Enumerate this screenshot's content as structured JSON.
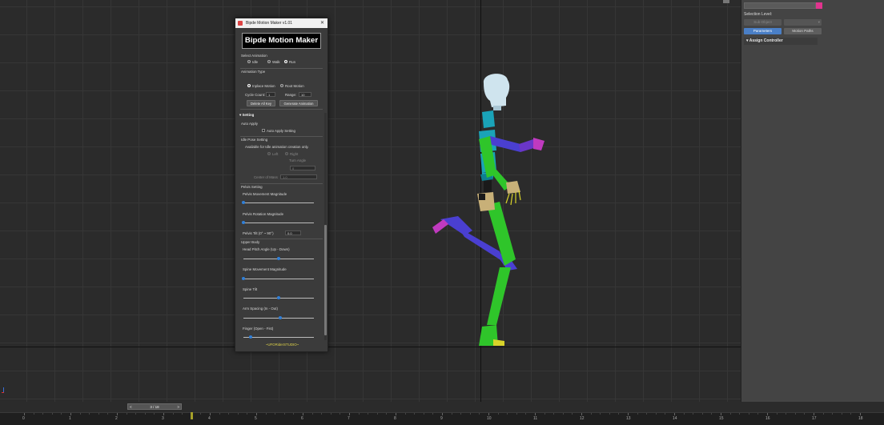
{
  "dialog": {
    "title": "Bipde Motion Maker v1.01",
    "logo_text": "Bipde Motion Maker",
    "close_glyph": "✕",
    "select_animation": {
      "label": "Select Animation",
      "options": [
        "Idle",
        "Walk",
        "Run"
      ],
      "selected": "Run"
    },
    "animation_type": {
      "label": "Animation Type",
      "options": [
        "Inplace Motion",
        "Root Motion"
      ],
      "selected": "Inplace Motion",
      "cycle_count_label": "Cycle Count:",
      "cycle_count_value": "1",
      "range_label": "Range:",
      "range_value": "10",
      "delete_button": "Delete All Key",
      "generate_button": "Generate Animation"
    },
    "setting": {
      "header": "Setting",
      "auto_apply_label": "Auto Apply",
      "auto_apply_checkbox": "Auto Apply Setting",
      "idle_pose_label": "Idle Pose Setting",
      "idle_pose_note": "Available for Idle animation creation only.",
      "left_label": "Left",
      "right_label": "Right",
      "turn_angle_label": "Turn Angle",
      "turn_angle_value": "0",
      "center_of_mass_label": "Center of Mass",
      "center_of_mass_value": "1.0"
    },
    "pelvis": {
      "label": "Pelvis Setting",
      "movement_label": "Pelvis Movement Magnitude",
      "movement_value": 0.0,
      "rotation_label": "Pelvis Rotation Magnitude",
      "rotation_value": 0.0,
      "tilt_label": "Pelvis Tilt (0° ~ 90°)",
      "tilt_value": "0.0"
    },
    "upper_body": {
      "label": "Upper Body",
      "head_pitch_label": "Head Pitch Angle (Up - Down)",
      "head_pitch_value": 0.5,
      "spine_movement_label": "Spine Movement Magnitude",
      "spine_movement_value": 0.0,
      "spine_tilt_label": "Spine Tilt",
      "spine_tilt_value": 0.5,
      "arm_spacing_label": "Arm Spacing (In - Out)",
      "arm_spacing_value": 0.52,
      "finger_label": "Finger (Open - Fist)",
      "finger_value": 0.1
    },
    "footer": "~UFORiderSTUDIO~"
  },
  "command_panel": {
    "selection_level_label": "Selection Level:",
    "sub_object_button": "Sub-Object",
    "parameters_button": "Parameters",
    "motion_paths_button": "Motion Paths",
    "assign_controller_label": "Assign Controller",
    "accent_color": "#e0348e"
  },
  "timeline": {
    "frame_indicator": "3 / 18",
    "prev_arrow": "<",
    "next_arrow": ">",
    "ruler_labels": [
      "0",
      "1",
      "2",
      "3",
      "4",
      "5",
      "6",
      "7",
      "8",
      "9",
      "10",
      "11",
      "12",
      "13",
      "14",
      "15",
      "16",
      "17",
      "18"
    ]
  },
  "colors": {
    "biped_green": "#2fc52a",
    "biped_blue": "#4a3fd1",
    "biped_cyan": "#1aa3b8",
    "head": "#cfe4ee",
    "pelvis_tan": "#c8b078",
    "slider_blue": "#2f7fd8"
  }
}
